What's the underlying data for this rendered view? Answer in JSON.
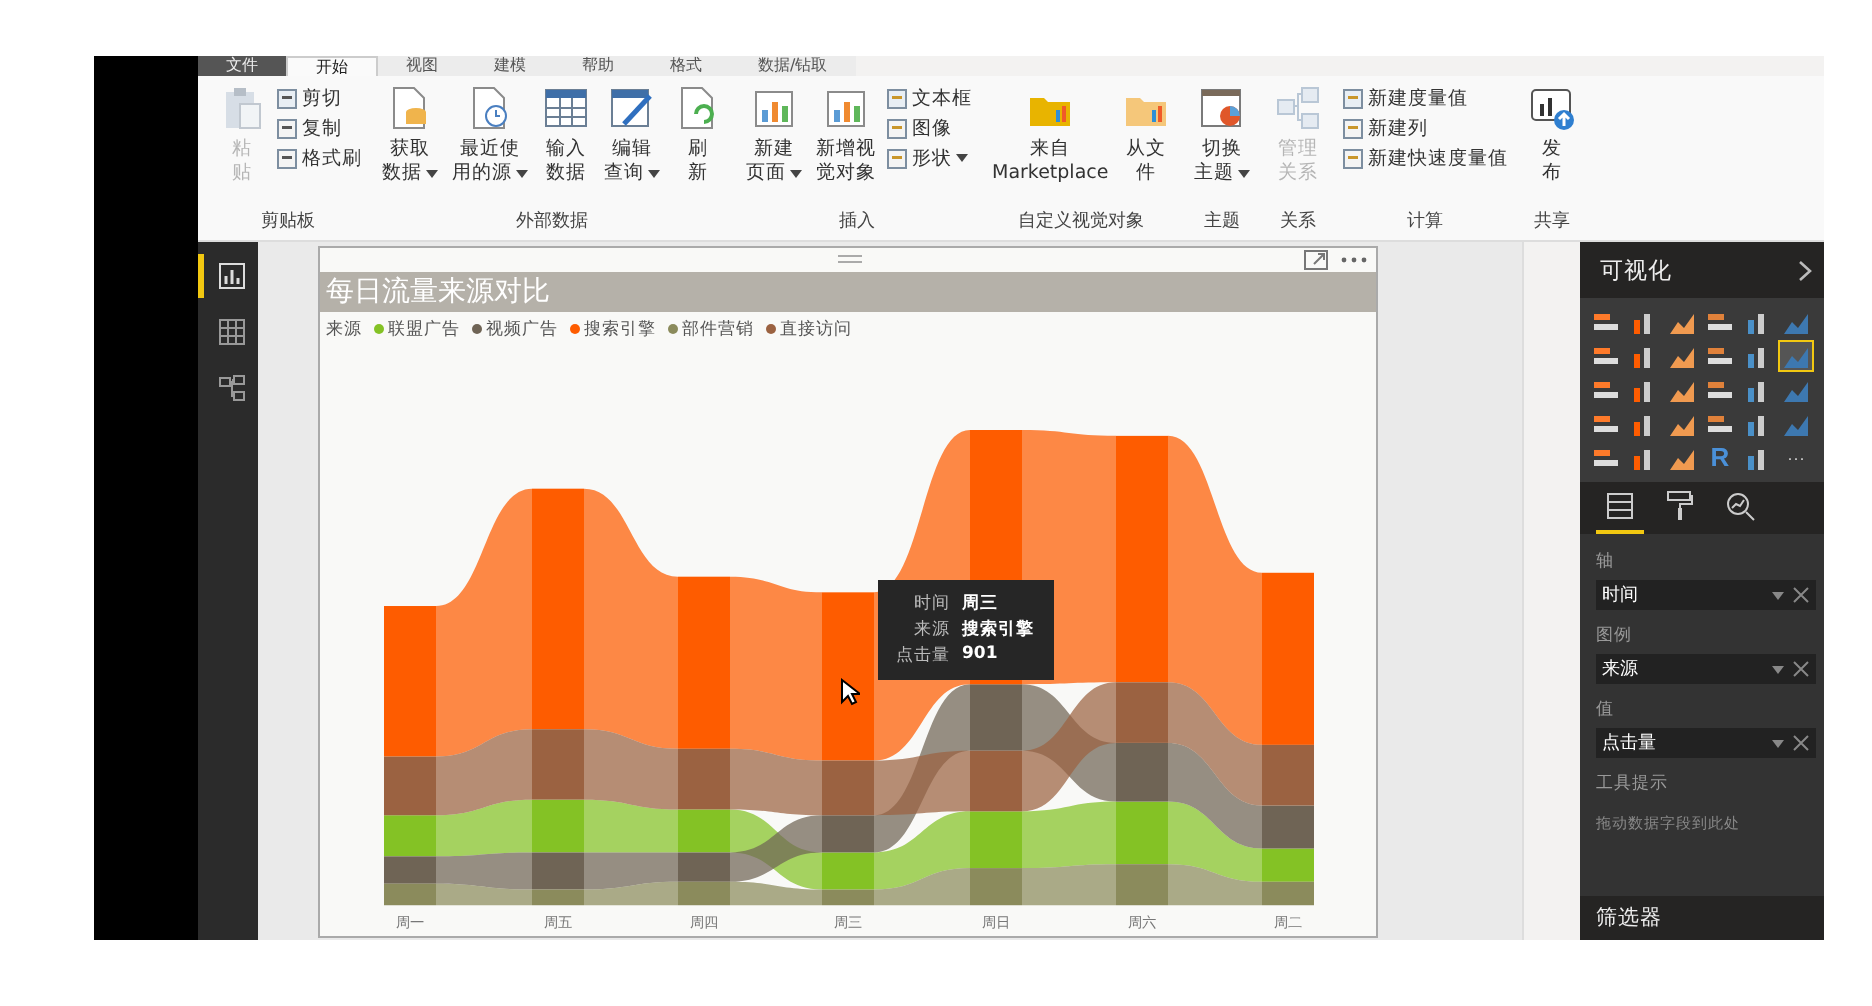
{
  "tabs": [
    {
      "label": "文件",
      "selected": false
    },
    {
      "label": "开始",
      "selected": true
    },
    {
      "label": "视图",
      "selected": false
    },
    {
      "label": "建模",
      "selected": false
    },
    {
      "label": "帮助",
      "selected": false
    },
    {
      "label": "格式",
      "selected": false
    },
    {
      "label": "数据/钻取",
      "selected": false
    }
  ],
  "ribbon": [
    {
      "label": "剪贴板",
      "items": [
        {
          "kind": "big",
          "lines": [
            "粘",
            "贴"
          ],
          "disabled": true,
          "dropdown": false
        },
        {
          "kind": "stack",
          "items": [
            {
              "label": "剪切",
              "dropdown": false
            },
            {
              "label": "复制",
              "dropdown": false
            },
            {
              "label": "格式刷",
              "dropdown": false
            }
          ]
        }
      ]
    },
    {
      "label": "外部数据",
      "items": [
        {
          "kind": "big",
          "lines": [
            "获取",
            "数据"
          ],
          "disabled": false,
          "dropdown": true
        },
        {
          "kind": "big",
          "lines": [
            "最近使",
            "用的源"
          ],
          "disabled": false,
          "dropdown": true
        },
        {
          "kind": "big",
          "lines": [
            "输入",
            "数据"
          ],
          "disabled": false,
          "dropdown": false
        },
        {
          "kind": "big",
          "lines": [
            "编辑",
            "查询"
          ],
          "disabled": false,
          "dropdown": true
        },
        {
          "kind": "big",
          "lines": [
            "刷",
            "新"
          ],
          "disabled": false,
          "dropdown": false
        }
      ]
    },
    {
      "label": "插入",
      "items": [
        {
          "kind": "big",
          "lines": [
            "新建",
            "页面"
          ],
          "disabled": false,
          "dropdown": true
        },
        {
          "kind": "big",
          "lines": [
            "新增视",
            "觉对象"
          ],
          "disabled": false,
          "dropdown": false
        },
        {
          "kind": "stack",
          "items": [
            {
              "label": "文本框",
              "dropdown": false
            },
            {
              "label": "图像",
              "dropdown": false
            },
            {
              "label": "形状",
              "dropdown": true
            }
          ]
        }
      ]
    },
    {
      "label": "自定义视觉对象",
      "items": [
        {
          "kind": "big",
          "lines": [
            "来自",
            "Marketplace"
          ],
          "disabled": false,
          "dropdown": false
        },
        {
          "kind": "big",
          "lines": [
            "从文",
            "件"
          ],
          "disabled": false,
          "dropdown": false
        }
      ]
    },
    {
      "label": "主题",
      "items": [
        {
          "kind": "big",
          "lines": [
            "切换",
            "主题"
          ],
          "disabled": false,
          "dropdown": true
        }
      ]
    },
    {
      "label": "关系",
      "items": [
        {
          "kind": "big",
          "lines": [
            "管理",
            "关系"
          ],
          "disabled": true,
          "dropdown": false
        }
      ]
    },
    {
      "label": "计算",
      "items": [
        {
          "kind": "stack",
          "items": [
            {
              "label": "新建度量值",
              "dropdown": false
            },
            {
              "label": "新建列",
              "dropdown": false
            },
            {
              "label": "新建快速度量值",
              "dropdown": false
            }
          ]
        }
      ]
    },
    {
      "label": "共享",
      "items": [
        {
          "kind": "big",
          "lines": [
            "发",
            "布"
          ],
          "disabled": false,
          "dropdown": false
        }
      ]
    }
  ],
  "nav": [
    {
      "selected": true
    },
    {
      "selected": false
    },
    {
      "selected": false
    }
  ],
  "visual": {
    "title": "每日流量来源对比",
    "legend_title": "来源",
    "legend": [
      {
        "label": "联盟广告",
        "color": "#84c225"
      },
      {
        "label": "视频广告",
        "color": "#6f6455"
      },
      {
        "label": "搜索引擎",
        "color": "#fe5c00"
      },
      {
        "label": "部件营销",
        "color": "#8b8b5c"
      },
      {
        "label": "直接访问",
        "color": "#9b6241"
      }
    ],
    "categories": [
      "周一",
      "周五",
      "周四",
      "周三",
      "周日",
      "周六",
      "周二"
    ],
    "tooltip": [
      {
        "label": "时间",
        "value": "周三"
      },
      {
        "label": "来源",
        "value": "搜索引擎"
      },
      {
        "label": "点击量",
        "value": "901"
      }
    ]
  },
  "panel": {
    "title": "可视化",
    "gallery": [
      {
        "selected": false
      },
      {
        "selected": false
      },
      {
        "selected": false
      },
      {
        "selected": false
      },
      {
        "selected": false
      },
      {
        "selected": false
      },
      {
        "selected": false
      },
      {
        "selected": false
      },
      {
        "selected": false
      },
      {
        "selected": false
      },
      {
        "selected": false
      },
      {
        "selected": true
      },
      {
        "selected": false
      },
      {
        "selected": false
      },
      {
        "selected": false
      },
      {
        "selected": false
      },
      {
        "selected": false
      },
      {
        "selected": false
      },
      {
        "selected": false
      },
      {
        "selected": false
      },
      {
        "selected": false
      },
      {
        "selected": false
      },
      {
        "selected": false
      },
      {
        "selected": false
      },
      {
        "selected": false
      },
      {
        "selected": false
      },
      {
        "selected": false
      },
      {
        "selected": false,
        "glyph": "R"
      },
      {
        "selected": false
      },
      {
        "selected": false,
        "glyph": "···"
      }
    ],
    "tabs": [
      {
        "selected": true
      },
      {
        "selected": false
      },
      {
        "selected": false
      }
    ],
    "wells": [
      {
        "label": "轴",
        "value": "时间"
      },
      {
        "label": "图例",
        "value": "来源"
      },
      {
        "label": "值",
        "value": "点击量"
      },
      {
        "label": "工具提示",
        "placeholder": "拖动数据字段到此处"
      }
    ],
    "filters": "筛选器"
  }
}
